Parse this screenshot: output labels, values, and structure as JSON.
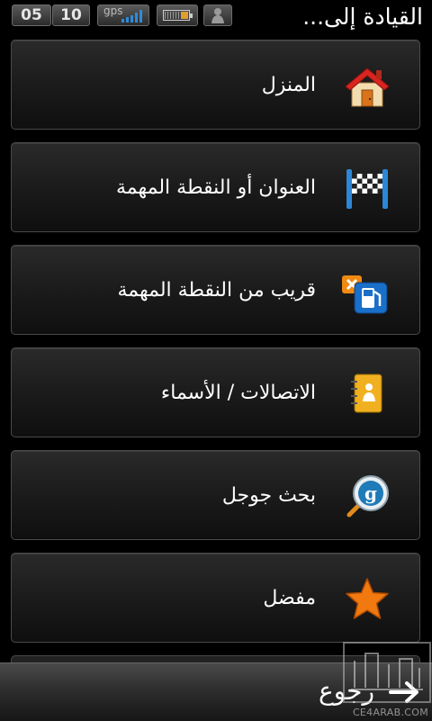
{
  "status_bar": {
    "hour": "05",
    "minute": "10",
    "gps_label": "gps",
    "signal_color": "#2f8bd8"
  },
  "header": {
    "title": "القيادة إلى..."
  },
  "menu": {
    "items": [
      {
        "label": "المنزل",
        "icon": "home-icon"
      },
      {
        "label": "العنوان أو النقطة المهمة",
        "icon": "checkered-flag-icon"
      },
      {
        "label": "قريب من النقطة المهمة",
        "icon": "gas-station-icon"
      },
      {
        "label": "الاتصالات / الأسماء",
        "icon": "contacts-book-icon"
      },
      {
        "label": "بحث جوجل",
        "icon": "google-search-icon"
      },
      {
        "label": "مفضل",
        "icon": "star-icon"
      }
    ]
  },
  "bottom_bar": {
    "back_label": "رجوع",
    "back_icon": "arrow-right-icon"
  },
  "watermark": {
    "text": "CE4ARAB.COM"
  }
}
